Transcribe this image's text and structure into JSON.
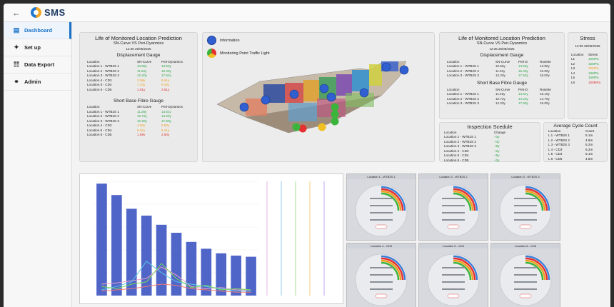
{
  "app": {
    "name": "SMS",
    "back_icon": "arrow-left-icon"
  },
  "sidebar": {
    "items": [
      {
        "label": "Dashboard",
        "icon": "bar-chart-icon",
        "active": true
      },
      {
        "label": "Set up",
        "icon": "wrench-icon",
        "active": false
      },
      {
        "label": "Data Export",
        "icon": "document-icon",
        "active": false
      },
      {
        "label": "Admin",
        "icon": "key-icon",
        "active": false
      }
    ]
  },
  "left_card": {
    "title": "Life of Monitored Location Prediction",
    "subtitle": "SN-Curve VS Peri-Dyanmics",
    "timestamp": "12:35 25/06/2025",
    "disp": {
      "title": "Displacement Gauge",
      "headers": [
        "Location",
        "SN-Curve",
        "Peri-Dynamics"
      ],
      "rows": [
        [
          "Location 1 - WTB2S 1",
          "10.56y",
          "13.53y",
          "g",
          "g"
        ],
        [
          "Location 2 - WTB2S 2",
          "11.52y",
          "15.40y",
          "g",
          "g"
        ],
        [
          "Location 3 - WTB2S 3",
          "12.20y",
          "17.52y",
          "g",
          "g"
        ],
        [
          "Location 4 - CD3",
          "3.58y",
          "5.61y",
          "o",
          "o"
        ],
        [
          "Location 5 - CD4",
          "7.10y",
          "9.30y",
          "o",
          "o"
        ],
        [
          "Location 6 - CD5",
          "1.91y",
          "2.51y",
          "r",
          "r"
        ]
      ]
    },
    "sbf": {
      "title": "Short Base Fibre Gauge",
      "headers": [
        "Location",
        "SN-Curve",
        "Peri-Dynamics"
      ],
      "rows": [
        [
          "Location 1 - WTB2S 1",
          "11.26y",
          "14.51y",
          "g",
          "g"
        ],
        [
          "Location 2 - WTB2S 2",
          "10.72y",
          "14.20y",
          "g",
          "g"
        ],
        [
          "Location 3 - WTB2S 3",
          "12.20y",
          "17.50y",
          "g",
          "g"
        ],
        [
          "Location 4 - CD3",
          "4.50y",
          "6.50y",
          "o",
          "o"
        ],
        [
          "Location 5 - CD4",
          "6.51y",
          "8.21y",
          "o",
          "o"
        ],
        [
          "Location 6 - CD5",
          "1.69y",
          "2.60y",
          "r",
          "r"
        ]
      ]
    }
  },
  "ship_card": {
    "legend": [
      {
        "label": "Information",
        "color": "#2f5fd0",
        "icon": "info-dot-icon"
      },
      {
        "label": "Monitoring Point Traffic Light",
        "color": "traffic",
        "icon": "traffic-light-icon"
      }
    ]
  },
  "right_card": {
    "title": "Life of Monitored Location Prediction",
    "subtitle": "SN-Curve VS Peri-Dyanmics",
    "timestamp": "12:35 25/06/2025",
    "disp": {
      "title": "Displacement Gauge",
      "headers": [
        "Location",
        "SN-Curve",
        "Peri-D",
        "Rosette"
      ],
      "rows": [
        [
          "Location 1 - WTB2S 1",
          "10.56y",
          "13.53y",
          "13.80y"
        ],
        [
          "Location 2 - WTB2S 2",
          "11.52y",
          "15.40y",
          "15.50y"
        ],
        [
          "Location 3 - WTB2S 3",
          "12.20y",
          "17.52y",
          "18.00y"
        ]
      ]
    },
    "sbf": {
      "title": "Short Base Fibre Gauge",
      "headers": [
        "Location",
        "SN-Curve",
        "Peri-D",
        "Rosette"
      ],
      "rows": [
        [
          "Location 1 - WTB2S 1",
          "11.26y",
          "14.51y",
          "15.10y"
        ],
        [
          "Location 2 - WTB2S 2",
          "10.72y",
          "14.20y",
          "14.70y"
        ],
        [
          "Location 3 - WTB2S 3",
          "12.20y",
          "17.50y",
          "18.00y"
        ]
      ]
    }
  },
  "stress_card": {
    "title": "Stress",
    "timestamp": "12:35 25/06/2025",
    "headers": [
      "Location",
      "Stress"
    ],
    "rows": [
      [
        "L1",
        "10MPa",
        "g"
      ],
      [
        "L2",
        "15MPa",
        "g"
      ],
      [
        "L3",
        "20MPa",
        "o"
      ],
      [
        "L4",
        "18MPa",
        "g"
      ],
      [
        "L5",
        "16MPa",
        "g"
      ],
      [
        "L6",
        "100MPa",
        "r"
      ]
    ]
  },
  "inspection_card": {
    "title": "Inspection Scedule",
    "headers": [
      "Location",
      "Change"
    ],
    "rows": [
      [
        "Location 1 - WTB2S 1",
        "+3y"
      ],
      [
        "Location 2 - WTB2S 2",
        "+4y"
      ],
      [
        "Location 3 - WTB2S 3",
        "+5y"
      ],
      [
        "Location 4 - CD3",
        "+2y"
      ],
      [
        "Location 5 - CD4",
        "+5y"
      ],
      [
        "Location 6 - CD5",
        "+3y"
      ]
    ]
  },
  "cycle_card": {
    "title": "Average Cycle Count",
    "headers": [
      "Location",
      "Count"
    ],
    "rows": [
      [
        "L 1 - WTB2S 1",
        "5.1m"
      ],
      [
        "L 2 - WTB2S 2",
        "4.8m"
      ],
      [
        "L 3 - WTB2S 3",
        "5.2m"
      ],
      [
        "L 4 - CD3",
        "5.2m"
      ],
      [
        "L 5 - CD4",
        "5.1m"
      ],
      [
        "L 6 - CD5",
        "4.8m"
      ]
    ]
  },
  "gauges": [
    {
      "title": "Location 1 - WTB2S 1"
    },
    {
      "title": "Location 2 - WTB2S 2"
    },
    {
      "title": "Location 3 - WTB2S 3"
    },
    {
      "title": "Location 4 - CD3"
    },
    {
      "title": "Location 5 - CD4"
    },
    {
      "title": "Location 6 - CD5"
    }
  ],
  "chart_data": {
    "type": "bar",
    "bar_color": "#4f66c8",
    "values": [
      98,
      88,
      76,
      70,
      62,
      55,
      47,
      41,
      37,
      35,
      34
    ],
    "ylim": [
      0,
      100
    ],
    "line_series": [
      {
        "color": "#f0a0c8",
        "values": [
          10,
          11,
          13,
          15,
          25,
          18,
          8,
          6,
          7,
          5,
          5
        ]
      },
      {
        "color": "#58c8e8",
        "values": [
          5,
          8,
          12,
          30,
          20,
          12,
          10,
          8,
          6,
          4,
          4
        ]
      },
      {
        "color": "#7ad85a",
        "values": [
          8,
          6,
          10,
          12,
          28,
          15,
          7,
          9,
          5,
          6,
          5
        ]
      },
      {
        "color": "#f07878",
        "values": [
          4,
          5,
          6,
          8,
          10,
          9,
          6,
          5,
          4,
          3,
          3
        ]
      }
    ],
    "axis_colors": [
      "#e8a0e0",
      "#80c0f0",
      "#90d870",
      "#f0c060",
      "#b090f0"
    ]
  }
}
